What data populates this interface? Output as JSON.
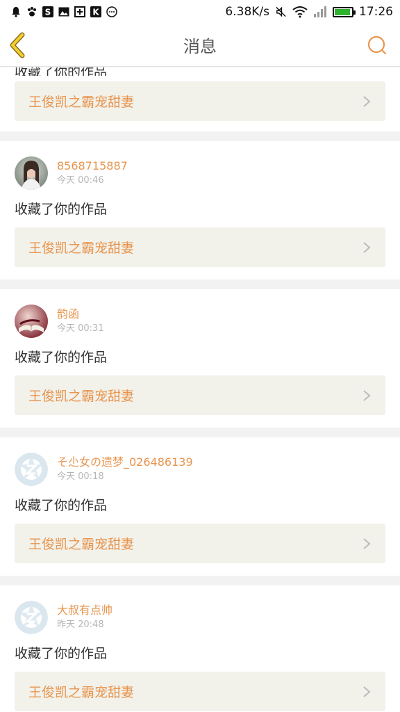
{
  "status_bar": {
    "network_speed": "6.38K/s",
    "time": "17:26",
    "icons": [
      "bell-clock-icon",
      "paw-icon",
      "s-app-icon",
      "image-icon",
      "plus-box-icon",
      "k-app-icon",
      "more-dots-icon",
      "mute-icon",
      "wifi-icon",
      "signal-icon",
      "battery-icon"
    ],
    "battery_level": 0.9,
    "battery_color": "#2fb32f"
  },
  "nav": {
    "title": "消息",
    "accent_color": "#e8954e"
  },
  "feed": {
    "partial_top": {
      "action": "收藏了你的作品",
      "work_title": "王俊凯之霸宠甜妻"
    },
    "items": [
      {
        "user": "8568715887",
        "time": "今天 00:46",
        "action": "收藏了你的作品",
        "work_title": "王俊凯之霸宠甜妻",
        "avatar": "photo-girl"
      },
      {
        "user": "韵函",
        "time": "今天 00:31",
        "action": "收藏了你的作品",
        "work_title": "王俊凯之霸宠甜妻",
        "avatar": "photo-book"
      },
      {
        "user": "そ尐女の遗梦_026486139",
        "time": "今天 00:18",
        "action": "收藏了你的作品",
        "work_title": "王俊凯之霸宠甜妻",
        "avatar": "default-star"
      },
      {
        "user": "大叔有点帅",
        "time": "昨天 20:48",
        "action": "收藏了你的作品",
        "work_title": "王俊凯之霸宠甜妻",
        "avatar": "default-star"
      }
    ]
  }
}
